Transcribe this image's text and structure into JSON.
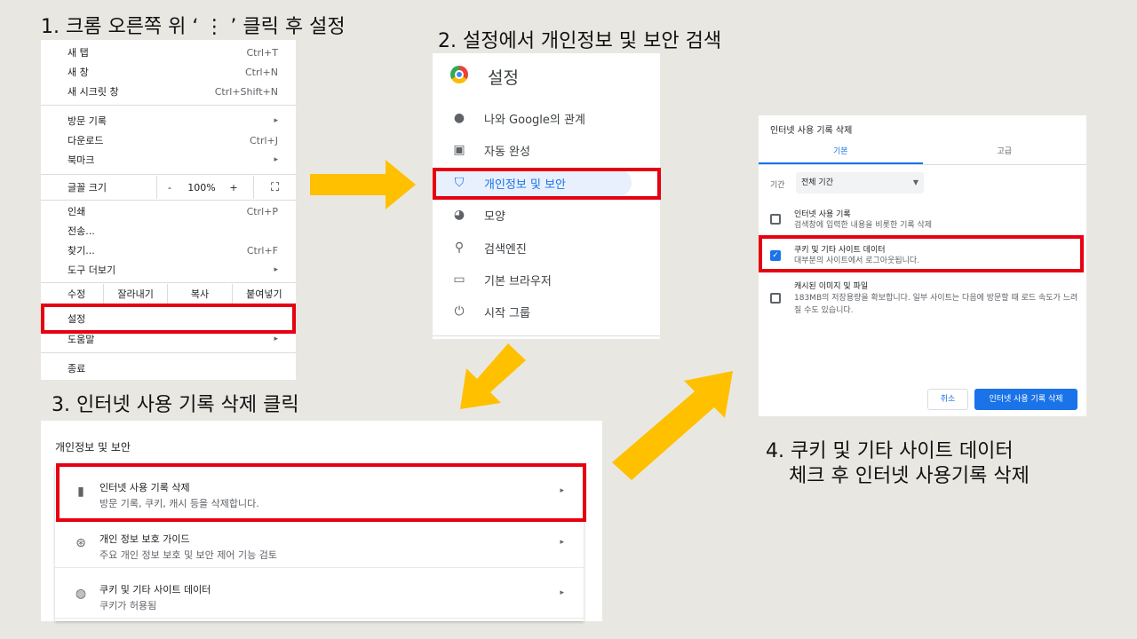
{
  "steps": {
    "step1": "1. 크롬 오른쪽 위 ‘ ⋮ ’ 클릭 후 설정",
    "step2": "2. 설정에서 개인정보 및 보안 검색",
    "step3": "3. 인터넷 사용 기록 삭제 클릭",
    "step4_line1": "4. 쿠키 및 기타 사이트 데이터",
    "step4_line2": "체크 후 인터넷 사용기록 삭제"
  },
  "menu": {
    "items": [
      {
        "label": "새 탭",
        "shortcut": "Ctrl+T"
      },
      {
        "label": "새 창",
        "shortcut": "Ctrl+N"
      },
      {
        "label": "새 시크릿 창",
        "shortcut": "Ctrl+Shift+N"
      },
      {
        "label": "방문 기록",
        "shortcut": "▸"
      },
      {
        "label": "다운로드",
        "shortcut": "Ctrl+J"
      },
      {
        "label": "북마크",
        "shortcut": "▸"
      },
      {
        "label": "인쇄",
        "shortcut": "Ctrl+P"
      },
      {
        "label": "전송...",
        "shortcut": ""
      },
      {
        "label": "찾기...",
        "shortcut": "Ctrl+F"
      },
      {
        "label": "도구 더보기",
        "shortcut": "▸"
      },
      {
        "label": "설정",
        "shortcut": ""
      },
      {
        "label": "도움말",
        "shortcut": "▸"
      },
      {
        "label": "종료",
        "shortcut": ""
      }
    ],
    "zoom": {
      "label": "글꼴 크기",
      "minus": "-",
      "value": "100%",
      "plus": "+",
      "fullscreen": "⛶"
    },
    "edit": {
      "label": "수정",
      "cut": "잘라내기",
      "copy": "복사",
      "paste": "붙여넣기"
    }
  },
  "settings": {
    "title": "설정",
    "items": [
      {
        "label": "나와 Google의 관계",
        "icon": "person-icon"
      },
      {
        "label": "자동 완성",
        "icon": "clipboard-icon"
      },
      {
        "label": "개인정보 및 보안",
        "icon": "shield-icon"
      },
      {
        "label": "모양",
        "icon": "palette-icon"
      },
      {
        "label": "검색엔진",
        "icon": "search-icon"
      },
      {
        "label": "기본 브라우저",
        "icon": "browser-icon"
      },
      {
        "label": "시작 그룹",
        "icon": "power-icon"
      }
    ]
  },
  "dialog": {
    "title": "인터넷 사용 기록 삭제",
    "tab_basic": "기본",
    "tab_advanced": "고급",
    "period_label": "기간",
    "period_value": "전체 기간",
    "opt1_title": "인터넷 사용 기록",
    "opt1_sub": "검색창에 입력한 내용을 비롯한 기록 삭제",
    "opt2_title": "쿠키 및 기타 사이트 데이터",
    "opt2_sub": "대부분의 사이트에서 로그아웃됩니다.",
    "opt3_title": "캐시된 이미지 및 파일",
    "opt3_sub": "183MB의 저장용량을 확보합니다. 일부 사이트는 다음에 방문할 때 로드 속도가 느려질 수도 있습니다.",
    "cancel": "취소",
    "confirm": "인터넷 사용 기록 삭제"
  },
  "privacy": {
    "heading": "개인정보 및 보안",
    "rows": [
      {
        "title": "인터넷 사용 기록 삭제",
        "sub": "방문 기록, 쿠키, 캐시 등을 삭제합니다."
      },
      {
        "title": "개인 정보 보호 가이드",
        "sub": "주요 개인 정보 보호 및 보안 제어 기능 검토"
      },
      {
        "title": "쿠키 및 기타 사이트 데이터",
        "sub": "쿠키가 허용됨"
      }
    ]
  },
  "colors": {
    "accent": "#1a73e8",
    "highlight": "#e60012",
    "arrow": "#ffc000"
  }
}
